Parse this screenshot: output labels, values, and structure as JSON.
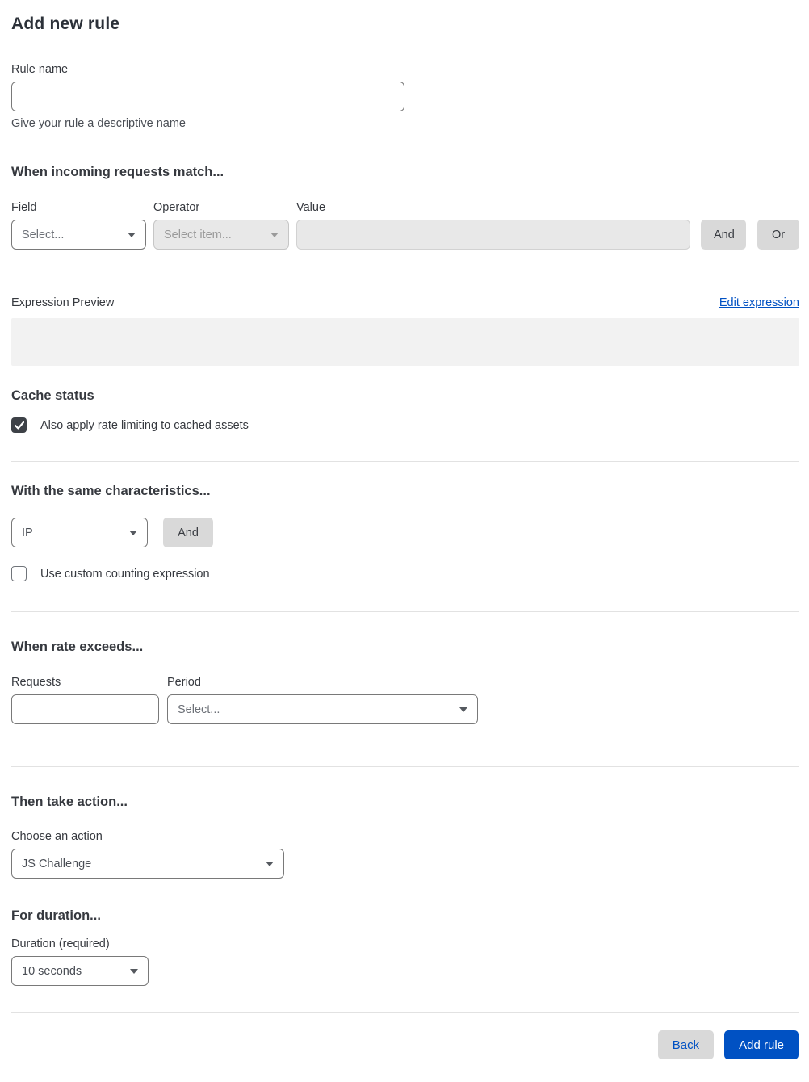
{
  "page_title": "Add new rule",
  "rule_name": {
    "label": "Rule name",
    "value": "",
    "helper": "Give your rule a descriptive name"
  },
  "match_section": {
    "heading": "When incoming requests match...",
    "field": {
      "label": "Field",
      "selected": "Select..."
    },
    "operator": {
      "label": "Operator",
      "selected": "Select item...",
      "disabled": true
    },
    "value": {
      "label": "Value",
      "value": "",
      "disabled": true
    },
    "and_button": "And",
    "or_button": "Or"
  },
  "expression": {
    "label": "Expression Preview",
    "edit_link": "Edit expression",
    "preview_content": ""
  },
  "cache_status": {
    "heading": "Cache status",
    "checkbox_label": "Also apply rate limiting to cached assets",
    "checked": true
  },
  "characteristics": {
    "heading": "With the same characteristics...",
    "selected": "IP",
    "and_button": "And",
    "checkbox_label": "Use custom counting expression",
    "checked": false
  },
  "rate_section": {
    "heading": "When rate exceeds...",
    "requests": {
      "label": "Requests",
      "value": ""
    },
    "period": {
      "label": "Period",
      "selected": "Select..."
    }
  },
  "action_section": {
    "heading": "Then take action...",
    "label": "Choose an action",
    "selected": "JS Challenge"
  },
  "duration_section": {
    "heading": "For duration...",
    "label": "Duration (required)",
    "selected": "10 seconds"
  },
  "footer": {
    "back": "Back",
    "submit": "Add rule"
  },
  "colors": {
    "accent_blue": "#0051c3",
    "button_gray": "#d9d9d9",
    "disabled_bg": "#e8e8e8",
    "checkbox_dark": "#3d4147",
    "preview_gray": "#f2f2f2"
  }
}
